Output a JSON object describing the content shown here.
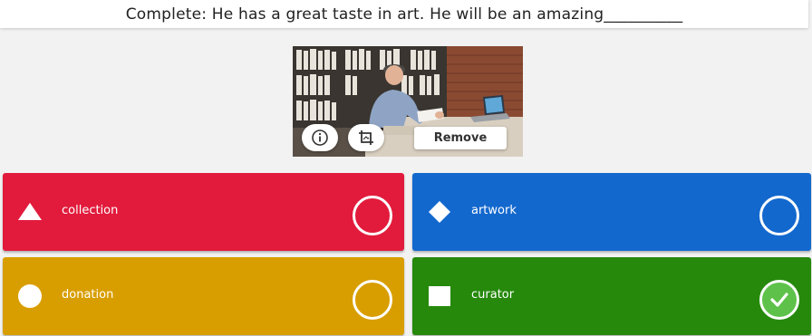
{
  "question": {
    "text": "Complete: He has a great taste in art. He will be an amazing__________"
  },
  "media": {
    "image_icon": "photo-of-man-at-desk-in-library",
    "info_icon": "info-icon",
    "crop_icon": "crop-icon",
    "remove_label": "Remove"
  },
  "answers": [
    {
      "label": "collection",
      "shape": "triangle-icon",
      "color": "#e21b3c",
      "selected": false
    },
    {
      "label": "artwork",
      "shape": "diamond-icon",
      "color": "#1368ce",
      "selected": false
    },
    {
      "label": "donation",
      "shape": "circle-icon",
      "color": "#d89e00",
      "selected": false
    },
    {
      "label": "curator",
      "shape": "square-icon",
      "color": "#26890c",
      "selected": true
    }
  ],
  "colors": {
    "check_fill": "#5ec24a",
    "background": "#f2f2f2"
  }
}
